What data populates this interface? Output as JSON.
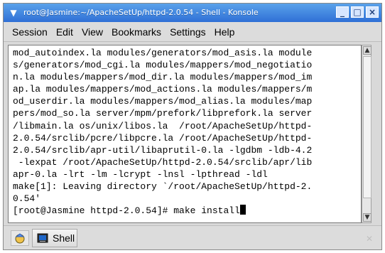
{
  "window": {
    "title": "root@Jasmine:~/ApacheSetUp/httpd-2.0.54 - Shell - Konsole",
    "controls": {
      "minimize": "_",
      "maximize": "□",
      "close": "×"
    }
  },
  "menu": {
    "items": [
      "Session",
      "Edit",
      "View",
      "Bookmarks",
      "Settings",
      "Help"
    ]
  },
  "terminal": {
    "lines": [
      "mod_autoindex.la modules/generators/mod_asis.la module",
      "s/generators/mod_cgi.la modules/mappers/mod_negotiatio",
      "n.la modules/mappers/mod_dir.la modules/mappers/mod_im",
      "ap.la modules/mappers/mod_actions.la modules/mappers/m",
      "od_userdir.la modules/mappers/mod_alias.la modules/map",
      "pers/mod_so.la server/mpm/prefork/libprefork.la server",
      "/libmain.la os/unix/libos.la  /root/ApacheSetUp/httpd-",
      "2.0.54/srclib/pcre/libpcre.la /root/ApacheSetUp/httpd-",
      "2.0.54/srclib/apr-util/libaprutil-0.la -lgdbm -ldb-4.2",
      " -lexpat /root/ApacheSetUp/httpd-2.0.54/srclib/apr/lib",
      "apr-0.la -lrt -lm -lcrypt -lnsl -lpthread -ldl",
      "make[1]: Leaving directory `/root/ApacheSetUp/httpd-2.",
      "0.54'"
    ],
    "prompt": "[root@Jasmine httpd-2.0.54]# make install"
  },
  "tabs": [
    {
      "label": "Shell"
    }
  ],
  "icons": {
    "window_menu": "chevron-down-icon",
    "new_session": "new-session-icon",
    "terminal_tab": "terminal-icon",
    "close_tab": "close-tab-icon"
  },
  "colors": {
    "titlebar": "#3b82e6",
    "terminal_bg": "#ffffff",
    "terminal_fg": "#000000"
  }
}
